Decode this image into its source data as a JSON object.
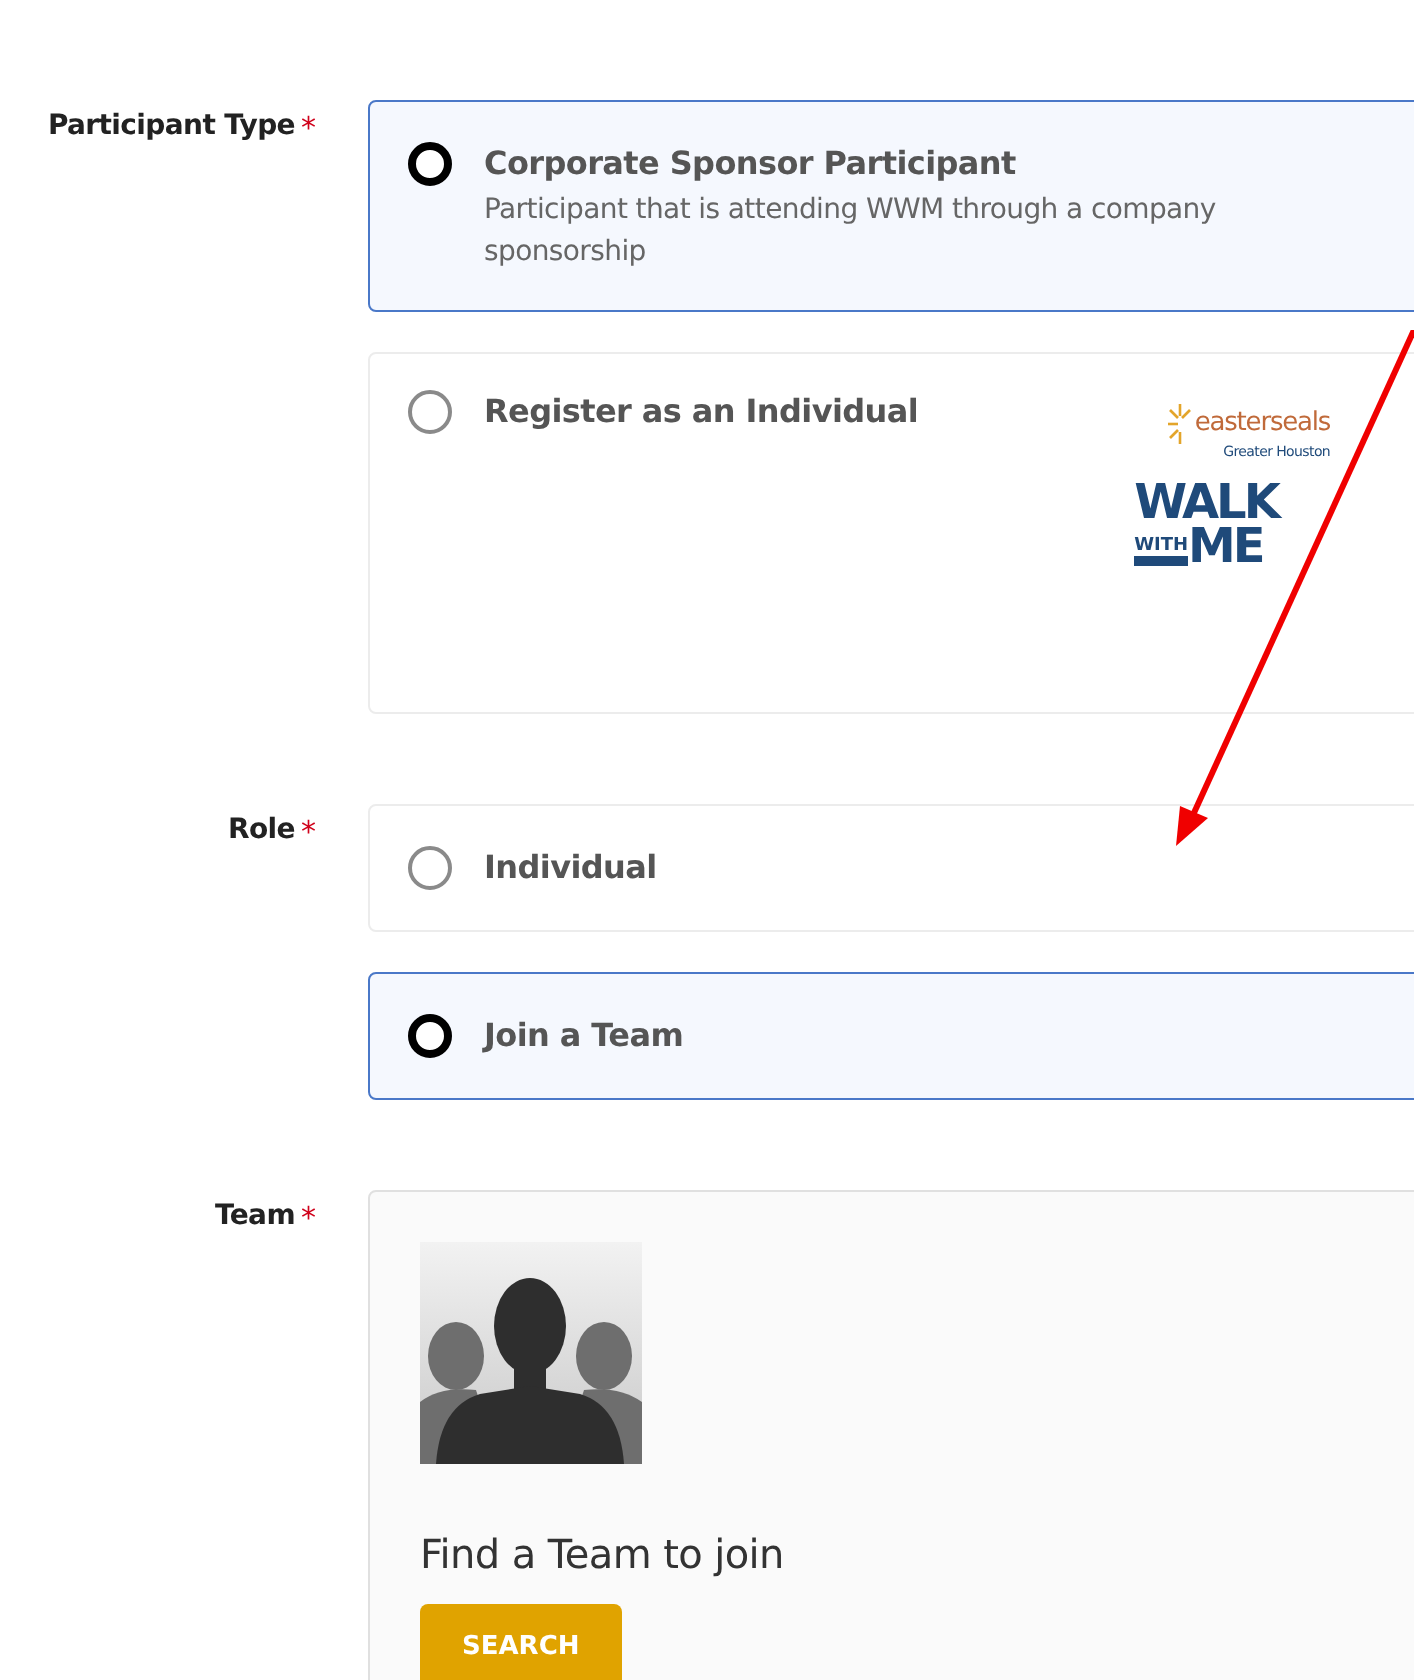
{
  "fields": [
    {
      "label": "Participant Type",
      "required_mark": "*",
      "kind": "radio",
      "options": [
        {
          "title": "Corporate Sponsor Participant",
          "description": "Participant that is attending WWM through a company sponsorship",
          "selected": true
        },
        {
          "title": "Register as an Individual",
          "selected": false,
          "logo": {
            "brand": "easterseals",
            "region": "Greater Houston",
            "line_1": "WALK",
            "line_2_small": "WITH",
            "line_2_large": "ME"
          }
        }
      ]
    },
    {
      "label": "Role",
      "required_mark": "*",
      "kind": "radio",
      "options": [
        {
          "title": "Individual",
          "selected": false
        },
        {
          "title": "Join a Team",
          "selected": true
        }
      ]
    },
    {
      "label": "Team",
      "required_mark": "*",
      "kind": "team",
      "prompt": "Find a Team to join",
      "button": "SEARCH"
    }
  ]
}
